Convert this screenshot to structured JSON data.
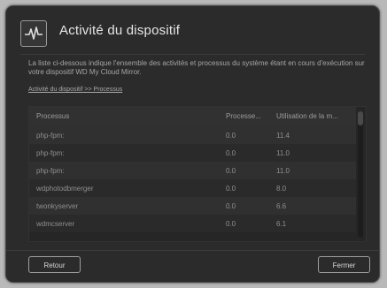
{
  "dialog": {
    "title": "Activité du dispositif",
    "title_icon": "activity-pulse-icon",
    "description": "La liste ci-dessous indique l'ensemble des activités et processus du système étant en cours d'exécution sur votre dispositif WD My Cloud Mirror.",
    "breadcrumb": "Activité du dispositif >> Processus"
  },
  "table": {
    "columns": [
      "Processus",
      "Processe...",
      "Utilisation de la m..."
    ],
    "rows": [
      [
        "php-fpm:",
        "0.0",
        "11.4"
      ],
      [
        "php-fpm:",
        "0.0",
        "11.0"
      ],
      [
        "php-fpm:",
        "0.0",
        "11.0"
      ],
      [
        "wdphotodbmerger",
        "0.0",
        "8.0"
      ],
      [
        "twonkyserver",
        "0.0",
        "6.6"
      ],
      [
        "wdmcserver",
        "0.0",
        "6.1"
      ]
    ]
  },
  "footer": {
    "back_label": "Retour",
    "close_label": "Fermer"
  },
  "colors": {
    "dialog_bg": "#2b2b2b",
    "page_bg": "#b9b9b9"
  }
}
